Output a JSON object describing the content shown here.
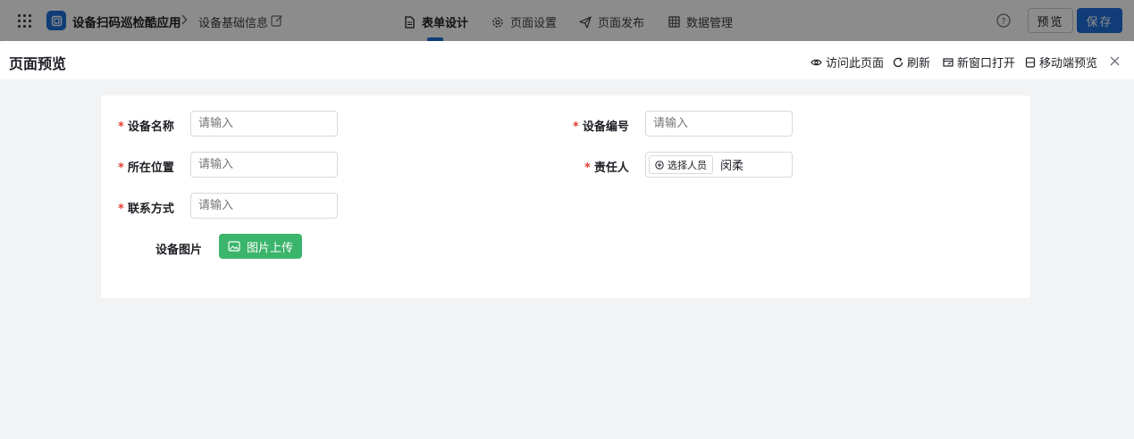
{
  "topbar": {
    "app_name": "设备扫码巡检酷应用",
    "breadcrumb": "设备基础信息",
    "tabs": [
      {
        "label": "表单设计",
        "icon": "document-icon",
        "active": true
      },
      {
        "label": "页面设置",
        "icon": "gear-icon",
        "active": false
      },
      {
        "label": "页面发布",
        "icon": "send-icon",
        "active": false
      },
      {
        "label": "数据管理",
        "icon": "table-icon",
        "active": false
      }
    ],
    "preview_label": "预览",
    "save_label": "保存"
  },
  "drawer": {
    "title": "页面预览",
    "actions": [
      {
        "label": "访问此页面",
        "icon": "eye-icon"
      },
      {
        "label": "刷新",
        "icon": "refresh-icon"
      },
      {
        "label": "新窗口打开",
        "icon": "new-window-icon"
      },
      {
        "label": "移动端预览",
        "icon": "mobile-icon"
      }
    ]
  },
  "form": {
    "device_name": {
      "label": "设备名称",
      "placeholder": "请输入",
      "required": true
    },
    "device_code": {
      "label": "设备编号",
      "placeholder": "请输入",
      "required": true
    },
    "location": {
      "label": "所在位置",
      "placeholder": "请输入",
      "required": true
    },
    "owner": {
      "label": "责任人",
      "button_label": "选择人员",
      "value": "闵柔",
      "required": true
    },
    "contact": {
      "label": "联系方式",
      "placeholder": "请输入",
      "required": true
    },
    "image": {
      "label": "设备图片",
      "button_label": "图片上传",
      "required": false
    }
  },
  "colors": {
    "primary": "#1e6fd9",
    "upload_green": "#3bb56b",
    "required_red": "#e03e2d"
  }
}
